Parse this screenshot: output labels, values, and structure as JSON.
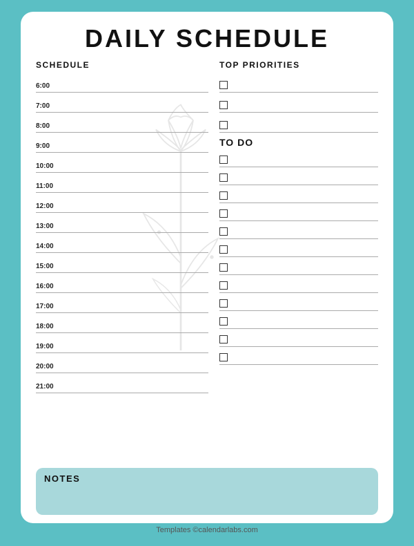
{
  "title": "DAILY SCHEDULE",
  "left_section": {
    "header": "SCHEDULE",
    "times": [
      "6:00",
      "7:00",
      "8:00",
      "9:00",
      "10:00",
      "11:00",
      "12:00",
      "13:00",
      "14:00",
      "15:00",
      "16:00",
      "17:00",
      "18:00",
      "19:00",
      "20:00",
      "21:00"
    ]
  },
  "right_section": {
    "priorities_header": "TOP PRIORITIES",
    "priorities_count": 3,
    "todo_header": "TO DO",
    "todo_count": 12
  },
  "notes": {
    "label": "NOTES"
  },
  "footer": "Templates ©calendarlabs.com"
}
